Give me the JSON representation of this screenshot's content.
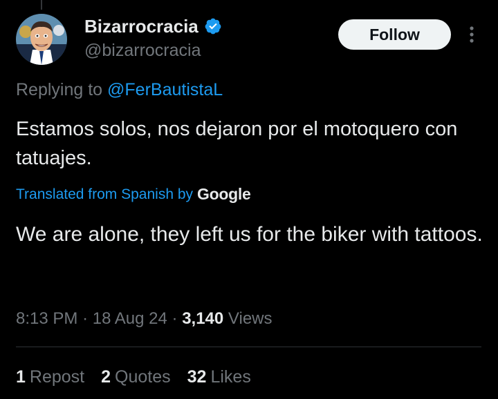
{
  "tweet": {
    "author": {
      "display_name": "Bizarrocracia",
      "handle": "@bizarrocracia",
      "verified_icon": "verified-badge-icon"
    },
    "follow_label": "Follow",
    "more_icon": "more-vertical-icon",
    "replying_prefix": "Replying to",
    "replying_to": "@FerBautistaL",
    "original_text": "Estamos solos, nos dejaron por el motoquero con tatuajes.",
    "translation": {
      "label": "Translated from Spanish by",
      "provider": "Google",
      "text": "We are alone, they left us for the biker with tattoos."
    },
    "time": "8:13 PM",
    "date": "18 Aug 24",
    "views_count": "3,140",
    "views_label": "Views",
    "stats": {
      "reposts_count": "1",
      "reposts_label": "Repost",
      "quotes_count": "2",
      "quotes_label": "Quotes",
      "likes_count": "32",
      "likes_label": "Likes"
    }
  },
  "colors": {
    "background": "#000000",
    "primary_text": "#e7e9ea",
    "secondary_text": "#71767b",
    "accent": "#1d9bf0",
    "follow_button_bg": "#eff3f4"
  }
}
